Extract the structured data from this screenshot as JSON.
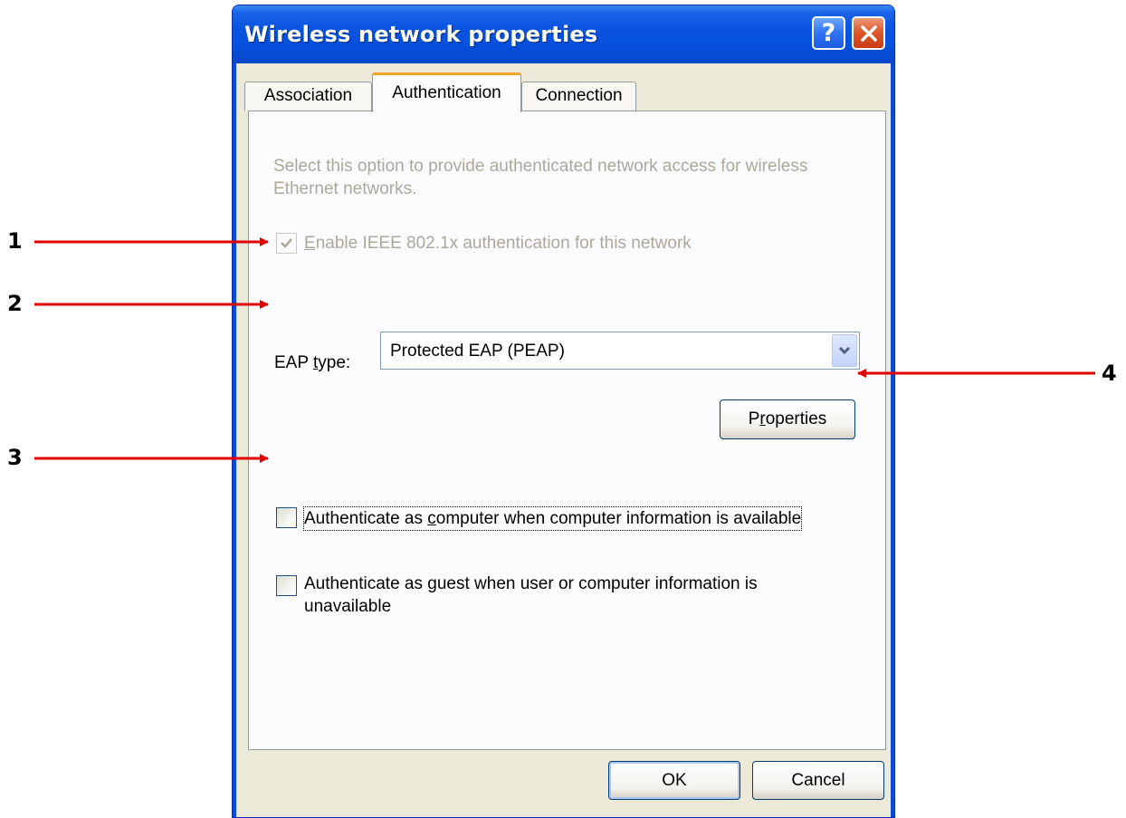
{
  "window": {
    "title": "Wireless network properties",
    "help_glyph": "?",
    "help_icon": "help-icon",
    "close_icon": "close-icon"
  },
  "tabs": [
    {
      "label": "Association",
      "selected": false
    },
    {
      "label": "Authentication",
      "selected": true
    },
    {
      "label": "Connection",
      "selected": false
    }
  ],
  "panel": {
    "description": "Select this option to provide authenticated network access for wireless Ethernet networks.",
    "enable_8021x": {
      "pre": "",
      "accel": "E",
      "post": "nable IEEE 802.1x authentication for this network",
      "checked": true,
      "disabled": true
    },
    "eap_type": {
      "label_pre": "EAP ",
      "accel": "t",
      "label_post": "ype:",
      "value": "Protected EAP (PEAP)"
    },
    "properties_button": {
      "pre": "P",
      "accel": "r",
      "post": "operties"
    },
    "auth_as_computer": {
      "pre": "Authenticate as ",
      "accel": "c",
      "post": "omputer when computer information is available",
      "checked": false
    },
    "auth_as_guest": {
      "pre": "Authenticate as ",
      "accel": "g",
      "post": "uest when user or computer information is",
      "line2": "unavailable",
      "checked": false
    }
  },
  "buttons": {
    "ok": {
      "label_pre": "",
      "accel": "",
      "label_post": "OK"
    },
    "cancel": {
      "label": "Cancel"
    }
  },
  "annotations": [
    {
      "number": "1"
    },
    {
      "number": "2"
    },
    {
      "number": "3"
    },
    {
      "number": "4"
    }
  ],
  "colors": {
    "annotation_arrow": "#e00000",
    "titlebar": "#0a54e0",
    "tab_highlight": "#f1a42e"
  }
}
